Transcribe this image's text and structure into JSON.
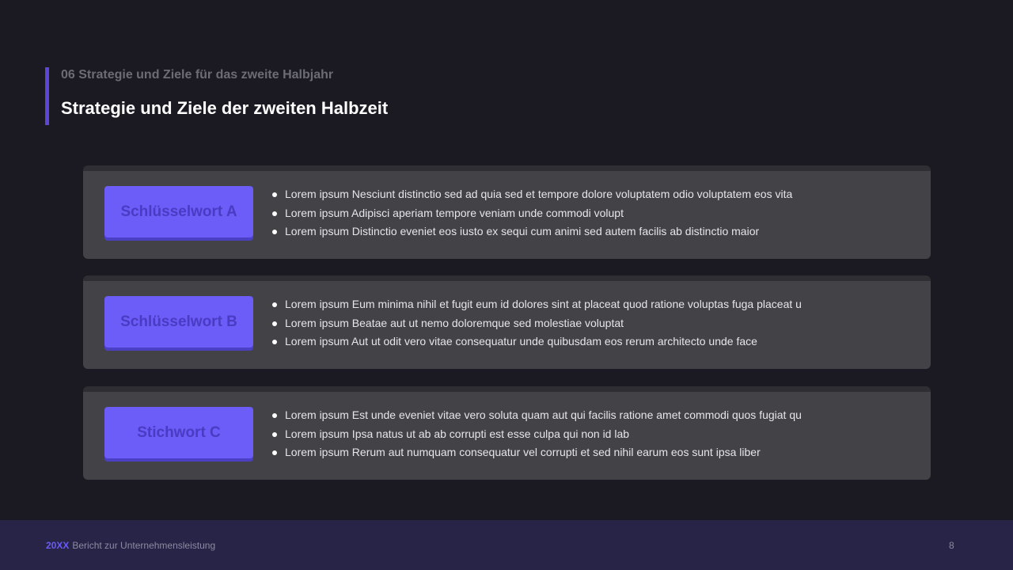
{
  "header": {
    "subtitle": "06 Strategie und Ziele für das zweite Halbjahr",
    "title": "Strategie und Ziele der zweiten Halbzeit"
  },
  "cards": [
    {
      "keyword": "Schlüsselwort A",
      "bullets": [
        "Lorem ipsum Nesciunt distinctio sed ad quia sed et tempore dolore voluptatem odio voluptatem eos vita",
        "Lorem ipsum Adipisci aperiam tempore veniam unde commodi volupt",
        "Lorem ipsum Distinctio eveniet eos iusto ex sequi cum animi sed autem facilis ab distinctio maior"
      ]
    },
    {
      "keyword": "Schlüsselwort B",
      "bullets": [
        "Lorem ipsum Eum minima nihil et fugit eum id dolores sint at placeat quod ratione voluptas fuga placeat u",
        "Lorem ipsum Beatae aut ut nemo doloremque sed molestiae voluptat",
        "Lorem ipsum Aut ut odit vero vitae consequatur unde quibusdam eos rerum architecto unde face"
      ]
    },
    {
      "keyword": "Stichwort C",
      "bullets": [
        "Lorem ipsum Est unde eveniet vitae vero soluta quam aut qui facilis ratione amet commodi quos fugiat qu",
        "Lorem ipsum Ipsa natus ut ab ab corrupti est esse culpa qui non id lab",
        "Lorem ipsum Rerum aut numquam consequatur vel corrupti et sed nihil earum eos sunt ipsa liber"
      ]
    }
  ],
  "footer": {
    "year": "20XX",
    "text": "Bericht zur Unternehmensleistung",
    "page_number": "8"
  },
  "colors": {
    "background": "#1b1a23",
    "accent": "#6c5cf8",
    "card": "#434246",
    "footer": "#282448"
  }
}
